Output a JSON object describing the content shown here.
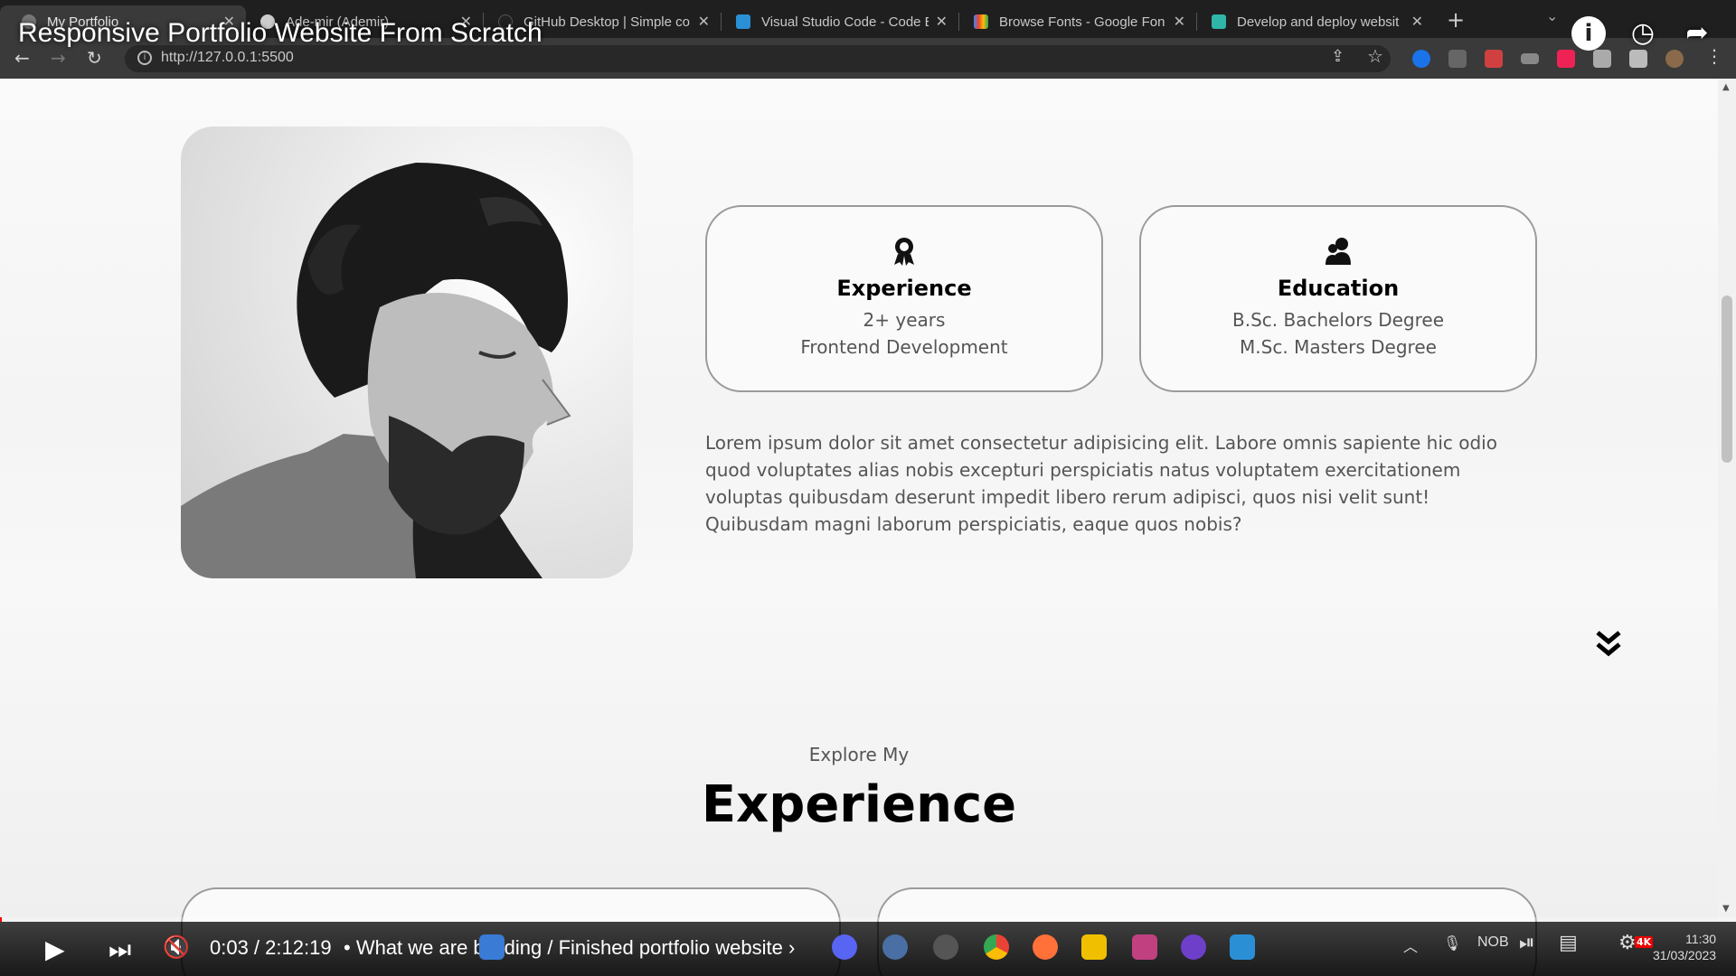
{
  "browser": {
    "tabs": [
      {
        "title": "My Portfolio",
        "active": true
      },
      {
        "title": "Ade-mir (Ademir)",
        "active": false
      },
      {
        "title": "GitHub Desktop | Simple co",
        "active": false
      },
      {
        "title": "Visual Studio Code - Code E",
        "active": false
      },
      {
        "title": "Browse Fonts - Google Fon",
        "active": false
      },
      {
        "title": "Develop and deploy websit",
        "active": false
      }
    ],
    "url": "http://127.0.0.1:5500"
  },
  "video": {
    "title": "Responsive Portfolio Website From Scratch",
    "time": "0:03 / 2:12:19",
    "chapter": "• What we are building / Finished portfolio website ›",
    "progress": 0.0004
  },
  "about": {
    "experience": {
      "heading": "Experience",
      "lines": [
        "2+ years",
        "Frontend Development"
      ]
    },
    "education": {
      "heading": "Education",
      "lines": [
        "B.Sc. Bachelors Degree",
        "M.Sc. Masters Degree"
      ]
    },
    "text": "Lorem ipsum dolor sit amet consectetur adipisicing elit. Labore omnis sapiente hic odio quod voluptates alias nobis excepturi perspiciatis natus voluptatem exercitationem voluptas quibusdam deserunt impedit libero rerum adipisci, quos nisi velit sunt! Quibusdam magni laborum perspiciatis, eaque quos nobis?"
  },
  "experience_section": {
    "subtitle": "Explore My",
    "title": "Experience"
  },
  "taskbar": {
    "lang": "NOB",
    "time": "11:30",
    "date": "31/03/2023",
    "badge": "4K"
  },
  "colors": {
    "accent_red": "#ff0000",
    "text_gray": "#555555",
    "border_gray": "#9a9a9a"
  }
}
